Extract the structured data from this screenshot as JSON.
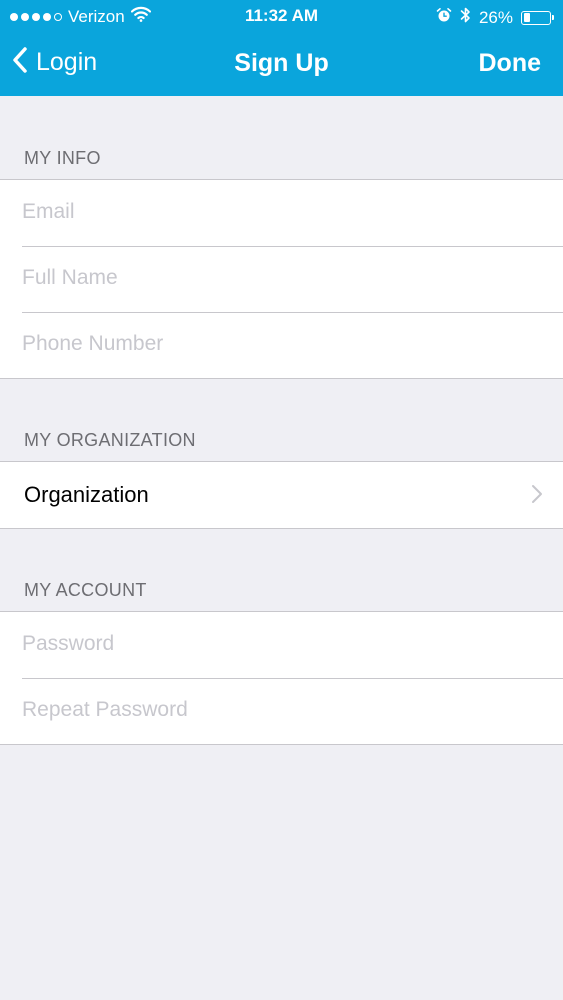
{
  "status_bar": {
    "carrier": "Verizon",
    "time": "11:32 AM",
    "battery_percent_label": "26%",
    "battery_level": 0.26,
    "signal_bars_filled": 4,
    "signal_bars_total": 5
  },
  "nav": {
    "back_label": "Login",
    "title": "Sign Up",
    "done_label": "Done"
  },
  "sections": {
    "my_info": {
      "header": "MY INFO",
      "email_placeholder": "Email",
      "full_name_placeholder": "Full Name",
      "phone_placeholder": "Phone Number"
    },
    "my_organization": {
      "header": "MY ORGANIZATION",
      "organization_label": "Organization"
    },
    "my_account": {
      "header": "MY ACCOUNT",
      "password_placeholder": "Password",
      "repeat_password_placeholder": "Repeat Password"
    }
  },
  "colors": {
    "accent": "#0aa5dc",
    "background": "#efeff4",
    "separator": "#c8c7cc",
    "placeholder": "#c7c7cd",
    "section_header": "#6d6d72"
  },
  "icons": {
    "back": "chevron-left-icon",
    "wifi": "wifi-icon",
    "alarm": "alarm-icon",
    "bluetooth": "bluetooth-icon",
    "battery": "battery-icon",
    "disclosure": "chevron-right-icon"
  }
}
